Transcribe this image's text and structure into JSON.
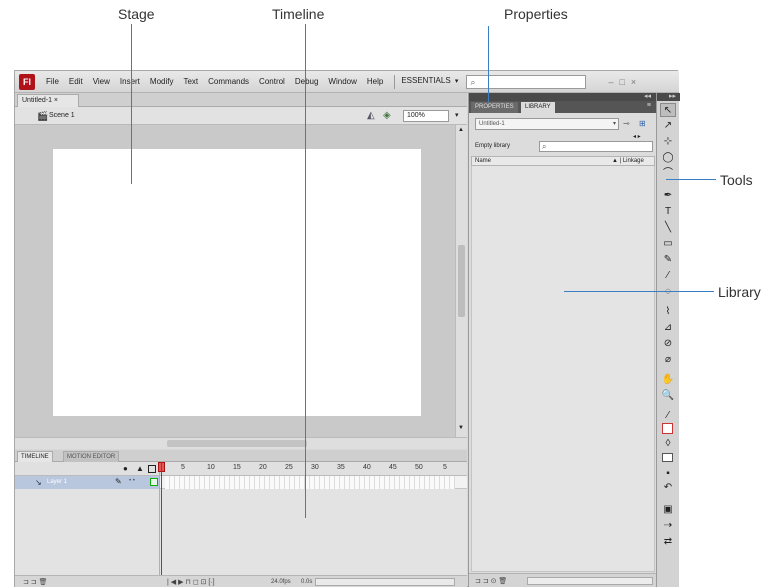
{
  "callouts": {
    "stage": "Stage",
    "timeline": "Timeline",
    "properties": "Properties",
    "tools": "Tools",
    "library": "Library"
  },
  "app": {
    "logo": "Fl",
    "menu": [
      "File",
      "Edit",
      "View",
      "Insert",
      "Modify",
      "Text",
      "Commands",
      "Control",
      "Debug",
      "Window",
      "Help"
    ],
    "workspace": "ESSENTIALS",
    "workspace_arrow": "▾",
    "search_icon": "⌕",
    "window_controls": [
      "–",
      "□",
      "×"
    ]
  },
  "document": {
    "tab_label": "Untitled-1 ×",
    "scene_icon": "clapper-icon",
    "scene_label": "Scene 1",
    "edit_symbol_icon": "◭",
    "edit_object_icon": "◈",
    "zoom": "100%",
    "zoom_arrow": "▾",
    "scroll_up": "▲",
    "scroll_down": "▼",
    "stage_color": "#ffffff",
    "pasteboard_color": "#c9c9c9"
  },
  "timeline": {
    "tabs": [
      "TIMELINE",
      "MOTION EDITOR"
    ],
    "eye_icon": "👁",
    "lock_icon": "🔒",
    "frame_numbers": [
      "5",
      "10",
      "15",
      "20",
      "25",
      "30",
      "35",
      "40",
      "45",
      "50",
      "5"
    ],
    "layer": {
      "name": "Layer 1",
      "icon": "↘",
      "pencil": "✎",
      "dots": "• •"
    },
    "bottom_icons": "⊐ ⊐ 🗑",
    "controls": "| ◀ ▶ ⊓ ◻ ⊡ [·]",
    "fps": "24.0fps",
    "time": "0.0s",
    "playhead_color": "#d0221c"
  },
  "panel": {
    "tabs": [
      "PROPERTIES",
      "LIBRARY"
    ],
    "menu_icon": "≡",
    "grip": "◂◂",
    "document_select": "Untitled-1",
    "select_arrow": "▾",
    "pin_icon": "⊸",
    "new_library_icon": "⊞",
    "nav": "◂ ▸",
    "empty_label": "Empty library",
    "search_icon": "⌕",
    "columns": [
      "Name",
      "▲ | Linkage"
    ],
    "bottom_icons": "⊐ ⊐ ⊙ 🗑"
  },
  "tools": {
    "grip": "▸▸",
    "icons": [
      "↖",
      "↗",
      "⊹",
      "◯",
      "⌒",
      "✒",
      "T",
      "╲",
      "▭",
      "✎",
      "⁄",
      "◌",
      "⌇",
      "⊿",
      "⊘",
      "⌀",
      "✋",
      "🔍",
      "⁄",
      "",
      "◊",
      "",
      "▪",
      "↶",
      "▣",
      "⇢",
      "⇄"
    ]
  }
}
